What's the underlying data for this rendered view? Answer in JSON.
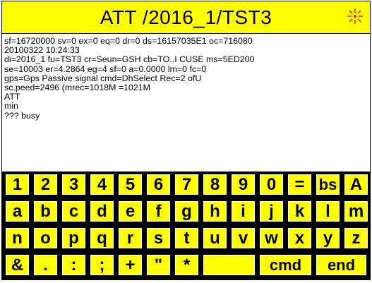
{
  "window": {
    "title": "ATT /2016_1/TST3",
    "status_icon": "sparkle-icon"
  },
  "console": {
    "lines": [
      "sf=16720000 sv=0 ex=0 eq=0 dr=0 ds=16157035E1 oc=716080",
      "20100322 10:24:33",
      "di=2016_1 fu=TST3 cr=Seun=GSH cb=TO..I CUSE ms=5ED200",
      "se=10003 er=4.2864 eg=4 sf=0 a=0.0000 lm=0 fc=0",
      "gps=Gps Passive signal cmd=DhSelect Rec=2 ofU",
      "sc.peed=2496 (mrec=1018M =1021M",
      "ATT",
      "min",
      "??? busy"
    ]
  },
  "keyboard": {
    "colors": {
      "key_fill": "#ffff00",
      "key_border": "#000000",
      "background": "#000000"
    },
    "rows": [
      [
        "1",
        "2",
        "3",
        "4",
        "5",
        "6",
        "7",
        "8",
        "9",
        "0",
        "=",
        "bs",
        "A"
      ],
      [
        "a",
        "b",
        "c",
        "d",
        "e",
        "f",
        "g",
        "h",
        "i",
        "j",
        "k",
        "l",
        "m"
      ],
      [
        "n",
        "o",
        "p",
        "q",
        "r",
        "s",
        "t",
        "u",
        "v",
        "w",
        "x",
        "y",
        "z"
      ],
      [
        "&",
        ".",
        ":",
        ";",
        "+",
        "\"",
        "*",
        "",
        "cmd",
        "end"
      ]
    ]
  }
}
